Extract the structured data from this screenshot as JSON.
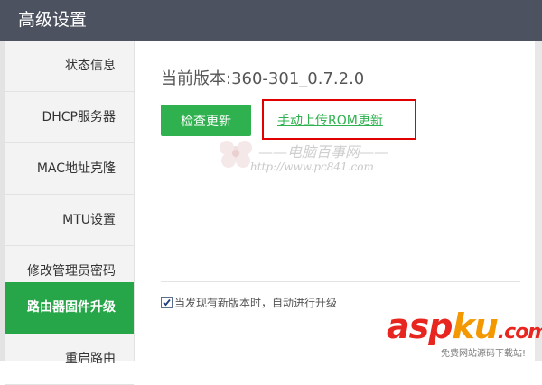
{
  "window": {
    "title": "高级设置"
  },
  "sidebar": {
    "items": [
      {
        "label": "状态信息",
        "active": false
      },
      {
        "label": "DHCP服务器",
        "active": false
      },
      {
        "label": "MAC地址克隆",
        "active": false
      },
      {
        "label": "MTU设置",
        "active": false
      },
      {
        "label": "修改管理员密码",
        "active": false
      },
      {
        "label": "路由器固件升级",
        "active": true
      },
      {
        "label": "重启路由",
        "active": false
      }
    ]
  },
  "main": {
    "version_text": "当前版本:360-301_0.7.2.0",
    "check_update_label": "检查更新",
    "manual_upload_label": "手动上传ROM更新",
    "auto_upgrade": {
      "label": "当发现有新版本时，自动进行升级",
      "checked": true
    }
  },
  "watermark": {
    "text": "——电脑百事网——",
    "url": "http://www.pc841.com"
  },
  "logo": {
    "part1": "asp",
    "part2": "ku",
    "suffix": ".com",
    "subtitle": "免费网站源码下载站!"
  },
  "colors": {
    "titlebar": "#4d5260",
    "accent_green": "#2fb14f",
    "highlight_red": "#e00000"
  }
}
